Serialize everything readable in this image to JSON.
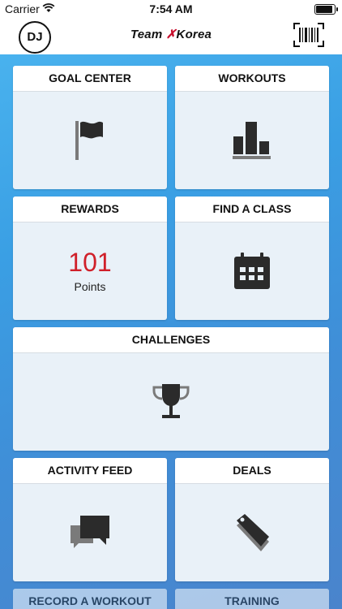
{
  "status_bar": {
    "carrier": "Carrier",
    "time": "7:54 AM"
  },
  "nav": {
    "avatar_initials": "DJ",
    "logo_text_a": "Team",
    "logo_text_b": "Korea",
    "barcode_icon": "barcode-icon"
  },
  "tiles": {
    "goal_center": {
      "label": "GOAL CENTER",
      "icon": "flag-icon"
    },
    "workouts": {
      "label": "WORKOUTS",
      "icon": "bar-chart-icon"
    },
    "rewards": {
      "label": "REWARDS",
      "points": "101",
      "points_label": "Points"
    },
    "find_a_class": {
      "label": "FIND A CLASS",
      "icon": "calendar-icon"
    },
    "challenges": {
      "label": "CHALLENGES",
      "icon": "trophy-icon"
    },
    "activity_feed": {
      "label": "ACTIVITY FEED",
      "icon": "chat-bubbles-icon"
    },
    "deals": {
      "label": "DEALS",
      "icon": "tag-icon"
    },
    "record_a_workout": {
      "label": "RECORD A WORKOUT"
    },
    "training": {
      "label": "TRAINING"
    }
  },
  "colors": {
    "accent_red": "#d0202a",
    "icon_dark": "#2b2b2b",
    "background_blue": "#3f9be3"
  }
}
